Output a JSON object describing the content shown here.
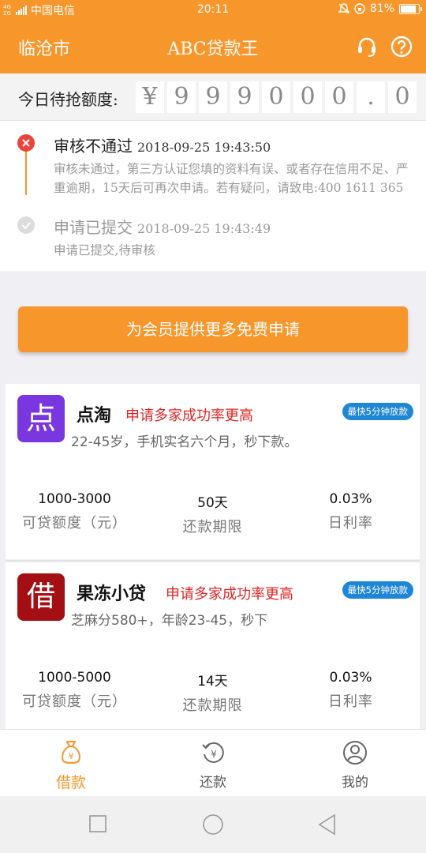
{
  "status_bar": {
    "network": "4G 2G",
    "carrier": "中国电信",
    "time": "20:11",
    "battery": "81%"
  },
  "header": {
    "city": "临沧市",
    "title": "ABC贷款王"
  },
  "quota": {
    "label": "今日待抢额度:",
    "digits": [
      "¥",
      "9",
      "9",
      "9",
      "0",
      "0",
      "0",
      ".",
      "0"
    ]
  },
  "timeline": [
    {
      "title": "审核不通过",
      "time": "2018-09-25 19:43:50",
      "desc": "审核未通过，第三方认证您填的资料有误、或者存在信用不足、严重逾期，15天后可再次申请。若有疑问，请致电:400 1611 365"
    },
    {
      "title": "申请已提交",
      "time": "2018-09-25 19:43:49",
      "desc": "申请已提交,待审核"
    }
  ],
  "cta_label": "为会员提供更多免费申请",
  "cards": [
    {
      "logo_char": "点",
      "name": "点淘",
      "slogan": "申请多家成功率更高",
      "badge": "最快5分钟放款",
      "desc": "22-45岁，手机实名六个月，秒下款。",
      "stats": [
        {
          "value": "1000-3000",
          "label": "可贷额度（元）"
        },
        {
          "value": "50天",
          "label": "还款期限"
        },
        {
          "value": "0.03%",
          "label": "日利率"
        }
      ]
    },
    {
      "logo_char": "借",
      "name": "果冻小贷",
      "slogan": "申请多家成功率更高",
      "badge": "最快5分钟放款",
      "desc": "芝麻分580+，年龄23-45，秒下",
      "stats": [
        {
          "value": "1000-5000",
          "label": "可贷额度（元）"
        },
        {
          "value": "14天",
          "label": "还款期限"
        },
        {
          "value": "0.03%",
          "label": "日利率"
        }
      ]
    }
  ],
  "nav": [
    {
      "label": "借款",
      "icon": "money-bag-icon"
    },
    {
      "label": "还款",
      "icon": "repay-icon"
    },
    {
      "label": "我的",
      "icon": "profile-icon"
    }
  ],
  "colors": {
    "accent": "#f7962b",
    "error": "#e8453c",
    "slogan": "#e02424",
    "badge": "#1e86d4"
  }
}
